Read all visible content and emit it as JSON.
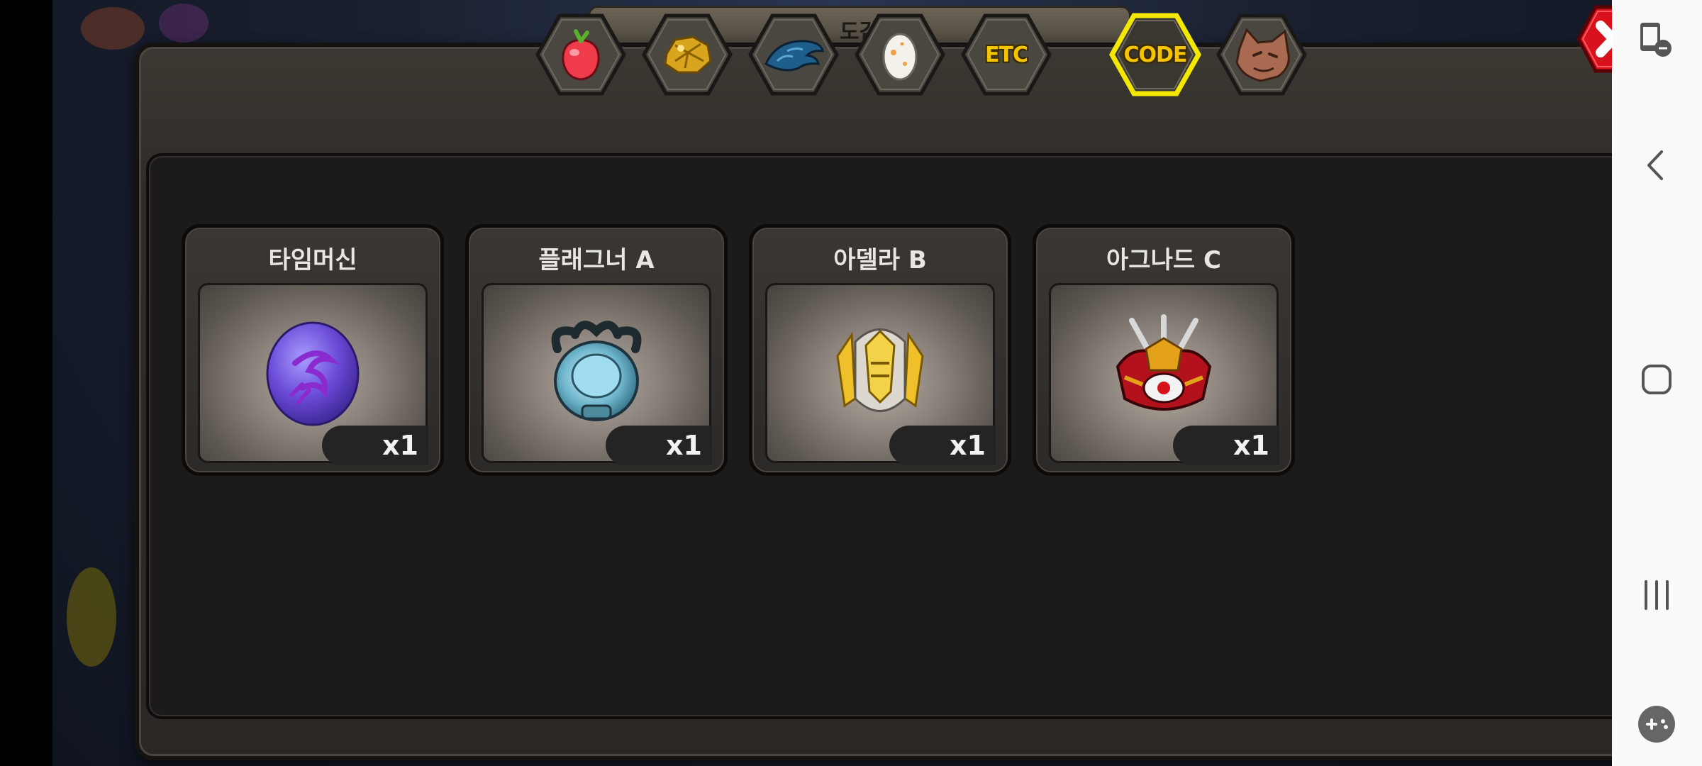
{
  "background": {
    "partial_tab_text": "도감/기록"
  },
  "tabs": [
    {
      "name": "fruit",
      "icon": "strawberry-icon",
      "label": ""
    },
    {
      "name": "gold",
      "icon": "gold-nugget-icon",
      "label": ""
    },
    {
      "name": "material",
      "icon": "blue-scale-icon",
      "label": ""
    },
    {
      "name": "egg",
      "icon": "egg-icon",
      "label": ""
    },
    {
      "name": "etc",
      "icon": "",
      "label": "ETC"
    },
    {
      "name": "code",
      "icon": "",
      "label": "CODE",
      "selected": true
    },
    {
      "name": "beast",
      "icon": "wolf-head-icon",
      "label": ""
    }
  ],
  "close_button": {
    "icon": "close-icon",
    "color": "#d8121c"
  },
  "items": [
    {
      "name": "타임머신",
      "icon": "purple-egg-icon",
      "quantity": "x1"
    },
    {
      "name": "플래그너 A",
      "icon": "teal-helmet-icon",
      "quantity": "x1"
    },
    {
      "name": "아델라 B",
      "icon": "gold-helmet-icon",
      "quantity": "x1"
    },
    {
      "name": "아그나드 C",
      "icon": "red-helmet-icon",
      "quantity": "x1"
    }
  ],
  "colors": {
    "selected_tab_glow": "#f5e800",
    "tab_text": "#f5c400",
    "panel": "#2f2c28",
    "inner": "#1c1b1a"
  },
  "navbar": {
    "buttons": [
      "screen-lock-icon",
      "back-icon",
      "home-icon",
      "recents-icon",
      "game-tools-icon"
    ]
  }
}
